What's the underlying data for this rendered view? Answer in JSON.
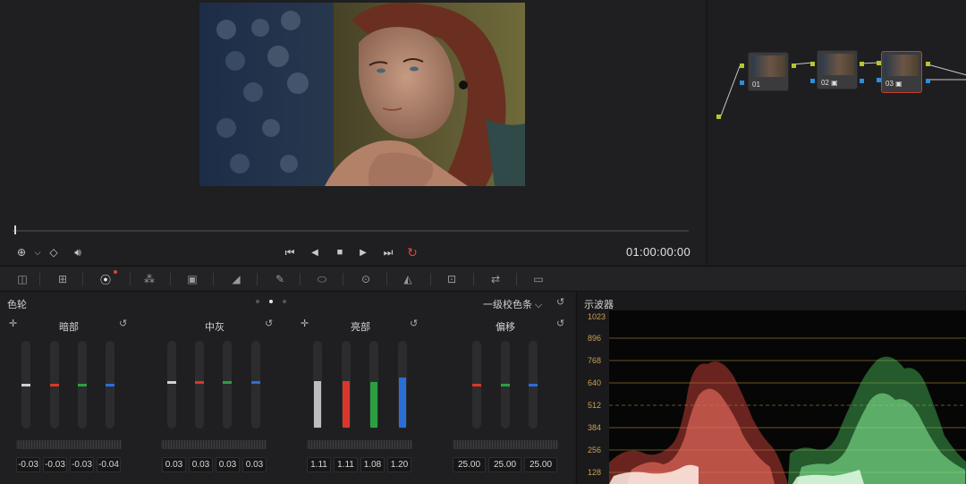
{
  "viewer": {
    "timecode": "01:00:00:00",
    "playback": {
      "skip_back": "⏮",
      "prev": "◀",
      "stop": "■",
      "play": "▶",
      "skip_fwd": "⏭",
      "loop": "↻"
    }
  },
  "nodes": [
    {
      "label": "01",
      "selected": false
    },
    {
      "label": "02 ▣",
      "selected": false
    },
    {
      "label": "03 ▣",
      "selected": true
    }
  ],
  "wheels": {
    "title": "色轮",
    "mode": "一级校色条 ⌵",
    "groups": [
      {
        "name": "暗部",
        "values": [
          "-0.03",
          "-0.03",
          "-0.03",
          "-0.04"
        ]
      },
      {
        "name": "中灰",
        "values": [
          "0.03",
          "0.03",
          "0.03",
          "0.03"
        ]
      },
      {
        "name": "亮部",
        "values": [
          "1.11",
          "1.11",
          "1.08",
          "1.20"
        ]
      },
      {
        "name": "偏移",
        "values": [
          "25.00",
          "25.00",
          "25.00"
        ]
      }
    ]
  },
  "scopes": {
    "title": "示波器",
    "y_labels": [
      "1023",
      "896",
      "768",
      "640",
      "512",
      "384",
      "256",
      "128"
    ]
  },
  "colors": {
    "accent_red": "#c83b2c",
    "node_green": "#b7c531",
    "node_blue": "#2c8fd8"
  }
}
